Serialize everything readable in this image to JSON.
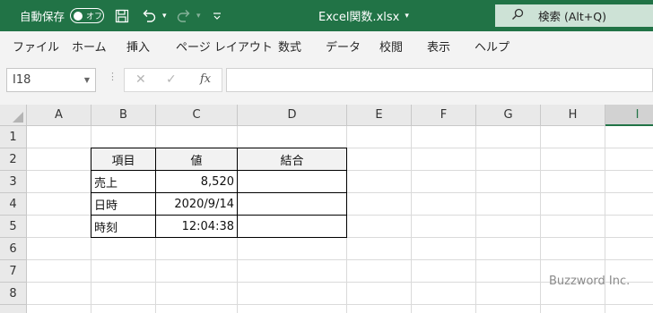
{
  "titlebar": {
    "autosave_label": "自動保存",
    "autosave_state": "オフ",
    "document_title": "Excel関数.xlsx",
    "search_label": "検索 (Alt+Q)",
    "accent_color": "#217346"
  },
  "menu": {
    "items": [
      "ファイル",
      "ホーム",
      "挿入",
      "ページ レイアウト",
      "数式",
      "データ",
      "校閲",
      "表示",
      "ヘルプ"
    ]
  },
  "formula_bar": {
    "name_box": "I18",
    "fx": "fx",
    "formula": ""
  },
  "sheet": {
    "columns": [
      "A",
      "B",
      "C",
      "D",
      "E",
      "F",
      "G",
      "H",
      "I"
    ],
    "rows": [
      "1",
      "2",
      "3",
      "4",
      "5",
      "6",
      "7",
      "8"
    ],
    "selected_column": "I",
    "table": {
      "headers": [
        "項目",
        "値",
        "結合"
      ],
      "rows": [
        [
          "売上",
          "8,520",
          ""
        ],
        [
          "日時",
          "2020/9/14",
          ""
        ],
        [
          "時刻",
          "12:04:38",
          ""
        ]
      ]
    }
  },
  "watermark": "Buzzword Inc."
}
